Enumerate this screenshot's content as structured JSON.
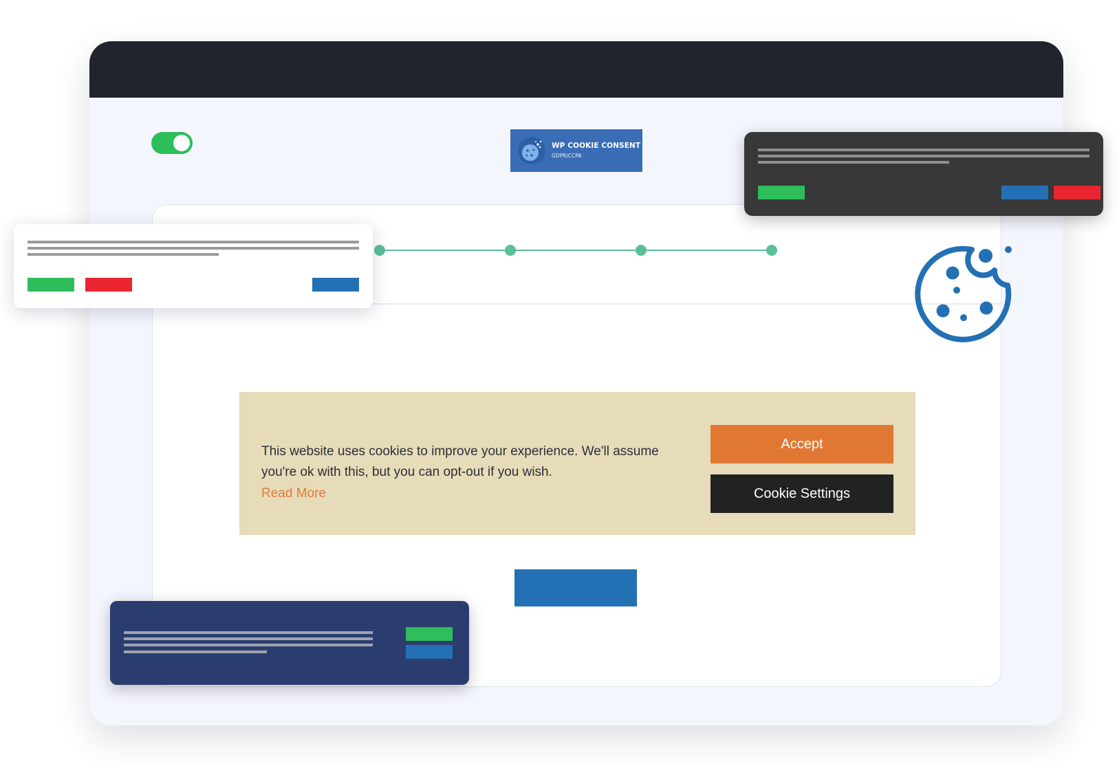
{
  "logo": {
    "title": "WP COOKIE CONSENT",
    "subtitle": "GDPR/CCPA",
    "icon": "cookie-icon"
  },
  "toggle": {
    "state": "on",
    "color": "#2dbd5a"
  },
  "progress": {
    "steps": 4,
    "color": "#5bbf98"
  },
  "consent_banner": {
    "message_line1": "This website uses cookies to improve your experience. We'll assume",
    "message_line2": "you're ok with this, but you can opt-out if you wish.",
    "read_more": "Read More",
    "accept_label": "Accept",
    "settings_label": "Cookie Settings",
    "background": "#e7dcb9",
    "accept_color": "#e07834",
    "settings_color": "#222222"
  },
  "mockups": {
    "light_banner": {
      "background": "#ffffff",
      "buttons": [
        "green",
        "red",
        "blue"
      ]
    },
    "dark_banner": {
      "background": "#383838",
      "buttons": [
        "green",
        "blue",
        "red"
      ]
    },
    "navy_banner": {
      "background": "#2b3d6e",
      "buttons": [
        "green",
        "blue"
      ]
    }
  },
  "colors": {
    "titlebar": "#20242c",
    "green": "#2dbd5a",
    "red": "#ea2530",
    "blue": "#2470b4",
    "cookie_icon": "#2470b4"
  }
}
